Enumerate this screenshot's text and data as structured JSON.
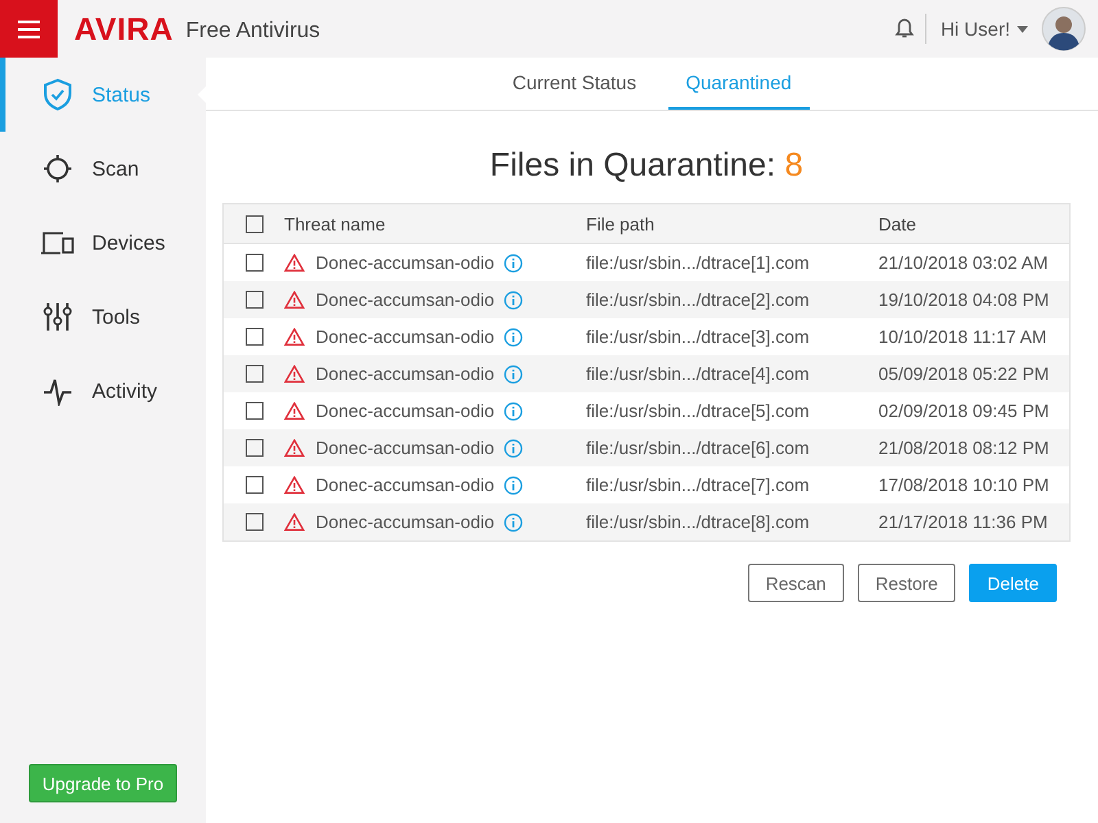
{
  "header": {
    "logo": "AVIRA",
    "product": "Free Antivirus",
    "user": "Hi User!"
  },
  "sidebar": {
    "items": [
      {
        "label": "Status",
        "selected": true
      },
      {
        "label": "Scan",
        "selected": false
      },
      {
        "label": "Devices",
        "selected": false
      },
      {
        "label": "Tools",
        "selected": false
      },
      {
        "label": "Activity",
        "selected": false
      }
    ],
    "upgrade_button": "Upgrade to Pro"
  },
  "tabs": [
    {
      "label": "Current Status",
      "selected": false
    },
    {
      "label": "Quarantined",
      "selected": true
    }
  ],
  "heading": {
    "label": "Files in Quarantine:",
    "count": "8"
  },
  "table": {
    "columns": [
      "Threat name",
      "File path",
      "Date"
    ],
    "all_checked": false,
    "rows": [
      {
        "checked": false,
        "name": "Donec-accumsan-odio",
        "path": "file:/usr/sbin.../dtrace[1].com",
        "date": "21/10/2018 03:02 AM"
      },
      {
        "checked": false,
        "name": "Donec-accumsan-odio",
        "path": "file:/usr/sbin.../dtrace[2].com",
        "date": "19/10/2018 04:08 PM"
      },
      {
        "checked": false,
        "name": "Donec-accumsan-odio",
        "path": "file:/usr/sbin.../dtrace[3].com",
        "date": "10/10/2018 11:17 AM"
      },
      {
        "checked": false,
        "name": "Donec-accumsan-odio",
        "path": "file:/usr/sbin.../dtrace[4].com",
        "date": "05/09/2018 05:22 PM"
      },
      {
        "checked": false,
        "name": "Donec-accumsan-odio",
        "path": "file:/usr/sbin.../dtrace[5].com",
        "date": "02/09/2018 09:45 PM"
      },
      {
        "checked": false,
        "name": "Donec-accumsan-odio",
        "path": "file:/usr/sbin.../dtrace[6].com",
        "date": "21/08/2018 08:12 PM"
      },
      {
        "checked": false,
        "name": "Donec-accumsan-odio",
        "path": "file:/usr/sbin.../dtrace[7].com",
        "date": "17/08/2018 10:10 PM"
      },
      {
        "checked": false,
        "name": "Donec-accumsan-odio",
        "path": "file:/usr/sbin.../dtrace[8].com",
        "date": "21/17/2018 11:36 PM"
      }
    ]
  },
  "actions": [
    {
      "label": "Rescan",
      "kind": "outline"
    },
    {
      "label": "Restore",
      "kind": "outline"
    },
    {
      "label": "Delete",
      "kind": "primary"
    }
  ]
}
